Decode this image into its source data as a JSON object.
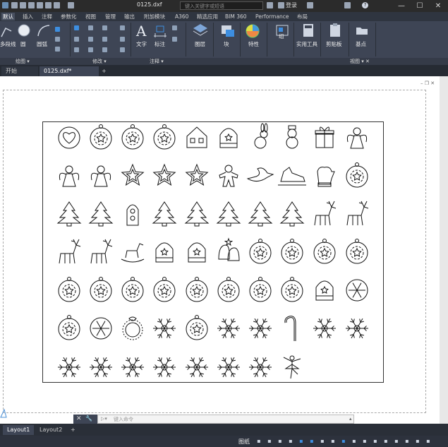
{
  "title_bar": {
    "file_name": "0125.dxf",
    "search_placeholder": "键入关键字或短语",
    "login_label": "登录",
    "help_icon": "?",
    "minimize": "—",
    "restore": "☐"
  },
  "ribbon_tabs": [
    "默认",
    "插入",
    "注释",
    "参数化",
    "视图",
    "管理",
    "输出",
    "附加模块",
    "A360",
    "精选应用",
    "BIM 360",
    "Performance",
    "布局"
  ],
  "active_tab": "默认",
  "ribbon": {
    "tools": [
      "多段线",
      "圆",
      "圆弧",
      "文字",
      "标注",
      "图层",
      "块",
      "特性",
      "组",
      "实用工具",
      "剪贴板",
      "基点"
    ]
  },
  "ribbon_footer": {
    "panels": [
      "绘图 ▾",
      "修改 ▾",
      "注释 ▾",
      "视图 ▾ ✕"
    ]
  },
  "file_tabs": {
    "start": "开始",
    "doc": "0125.dxf*",
    "add": "+"
  },
  "command": {
    "placeholder": "键入命令"
  },
  "layout_tabs": [
    "Layout1",
    "Layout2",
    "+"
  ],
  "status_bar": {
    "paper_label": "图纸"
  },
  "drawing": {
    "rows": [
      [
        "heart-ornament",
        "ornament-round",
        "ornament-round",
        "ornament-round",
        "house-ornament",
        "lantern-ornament",
        "rabbit",
        "snowman",
        "gift-box",
        "angel"
      ],
      [
        "angel",
        "angel",
        "star",
        "star",
        "star",
        "gingerbread-man",
        "dove",
        "ice-skates",
        "mitten",
        "tree-ball"
      ],
      [
        "christmas-tree",
        "christmas-tree",
        "candle-figure",
        "christmas-tree",
        "christmas-tree",
        "christmas-tree",
        "christmas-tree",
        "christmas-tree",
        "reindeer",
        "reindeer"
      ],
      [
        "reindeer",
        "reindeer",
        "rocking-horse",
        "bell",
        "bell",
        "bells-pair",
        "ornament-round",
        "ornament-round",
        "ornament-round",
        "ornament-round"
      ],
      [
        "ornament-round",
        "ornament-round",
        "ornament-round",
        "ornament-round",
        "ornament-round",
        "ornament-round",
        "ornament-round",
        "ornament-round",
        "bell-ornament",
        "snowflake-round"
      ],
      [
        "ornament-round",
        "snowflake-round",
        "wreath",
        "snowflake",
        "ornament-round",
        "snowflake",
        "snowflake",
        "candy-cane",
        "snowflake",
        "snowflake"
      ],
      [
        "snowflake",
        "snowflake",
        "snowflake",
        "snowflake",
        "snowflake",
        "snowflake",
        "snowflake",
        "ballerina"
      ]
    ]
  }
}
